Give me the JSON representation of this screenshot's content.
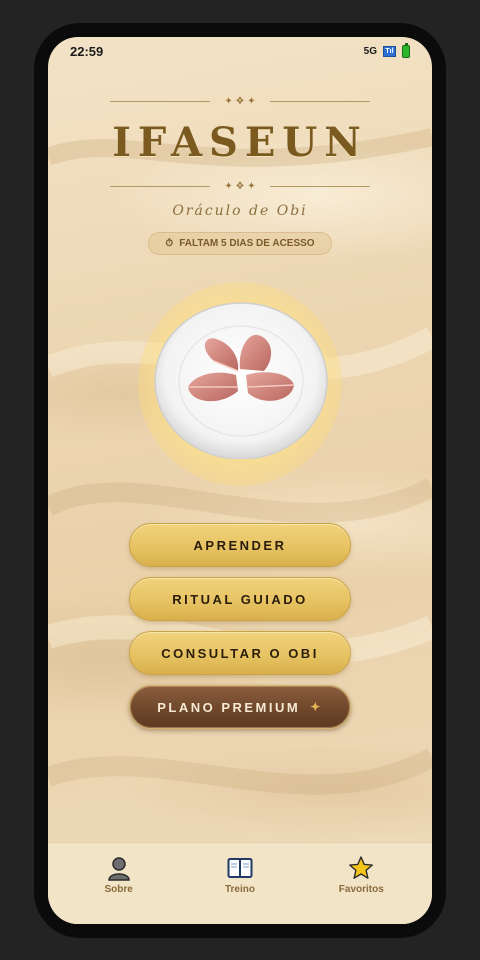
{
  "status_bar": {
    "time": "22:59",
    "network": "5G",
    "signal_label": "Tıl"
  },
  "header": {
    "ornament": "✦ ❖ ✦",
    "title": "IFASEUN",
    "subtitle": "Oráculo de Obi",
    "access_badge": {
      "icon": "⏱",
      "text": "FALTAM 5 DIAS DE ACESSO"
    }
  },
  "menu": {
    "buttons": [
      {
        "label": "APRENDER"
      },
      {
        "label": "RITUAL GUIADO"
      },
      {
        "label": "CONSULTAR O OBI"
      },
      {
        "label": "PLANO PREMIUM",
        "icon": "✦"
      }
    ]
  },
  "bottom_nav": {
    "items": [
      {
        "label": "Sobre",
        "icon": "person-icon"
      },
      {
        "label": "Treino",
        "icon": "book-icon"
      },
      {
        "label": "Favoritos",
        "icon": "star-icon"
      }
    ]
  },
  "colors": {
    "sand": "#ecd6b2",
    "gold_button": "#e5c160",
    "premium_button": "#6d4529",
    "title_brown": "#7a5a1f",
    "nav_label": "#8a6a3a"
  }
}
